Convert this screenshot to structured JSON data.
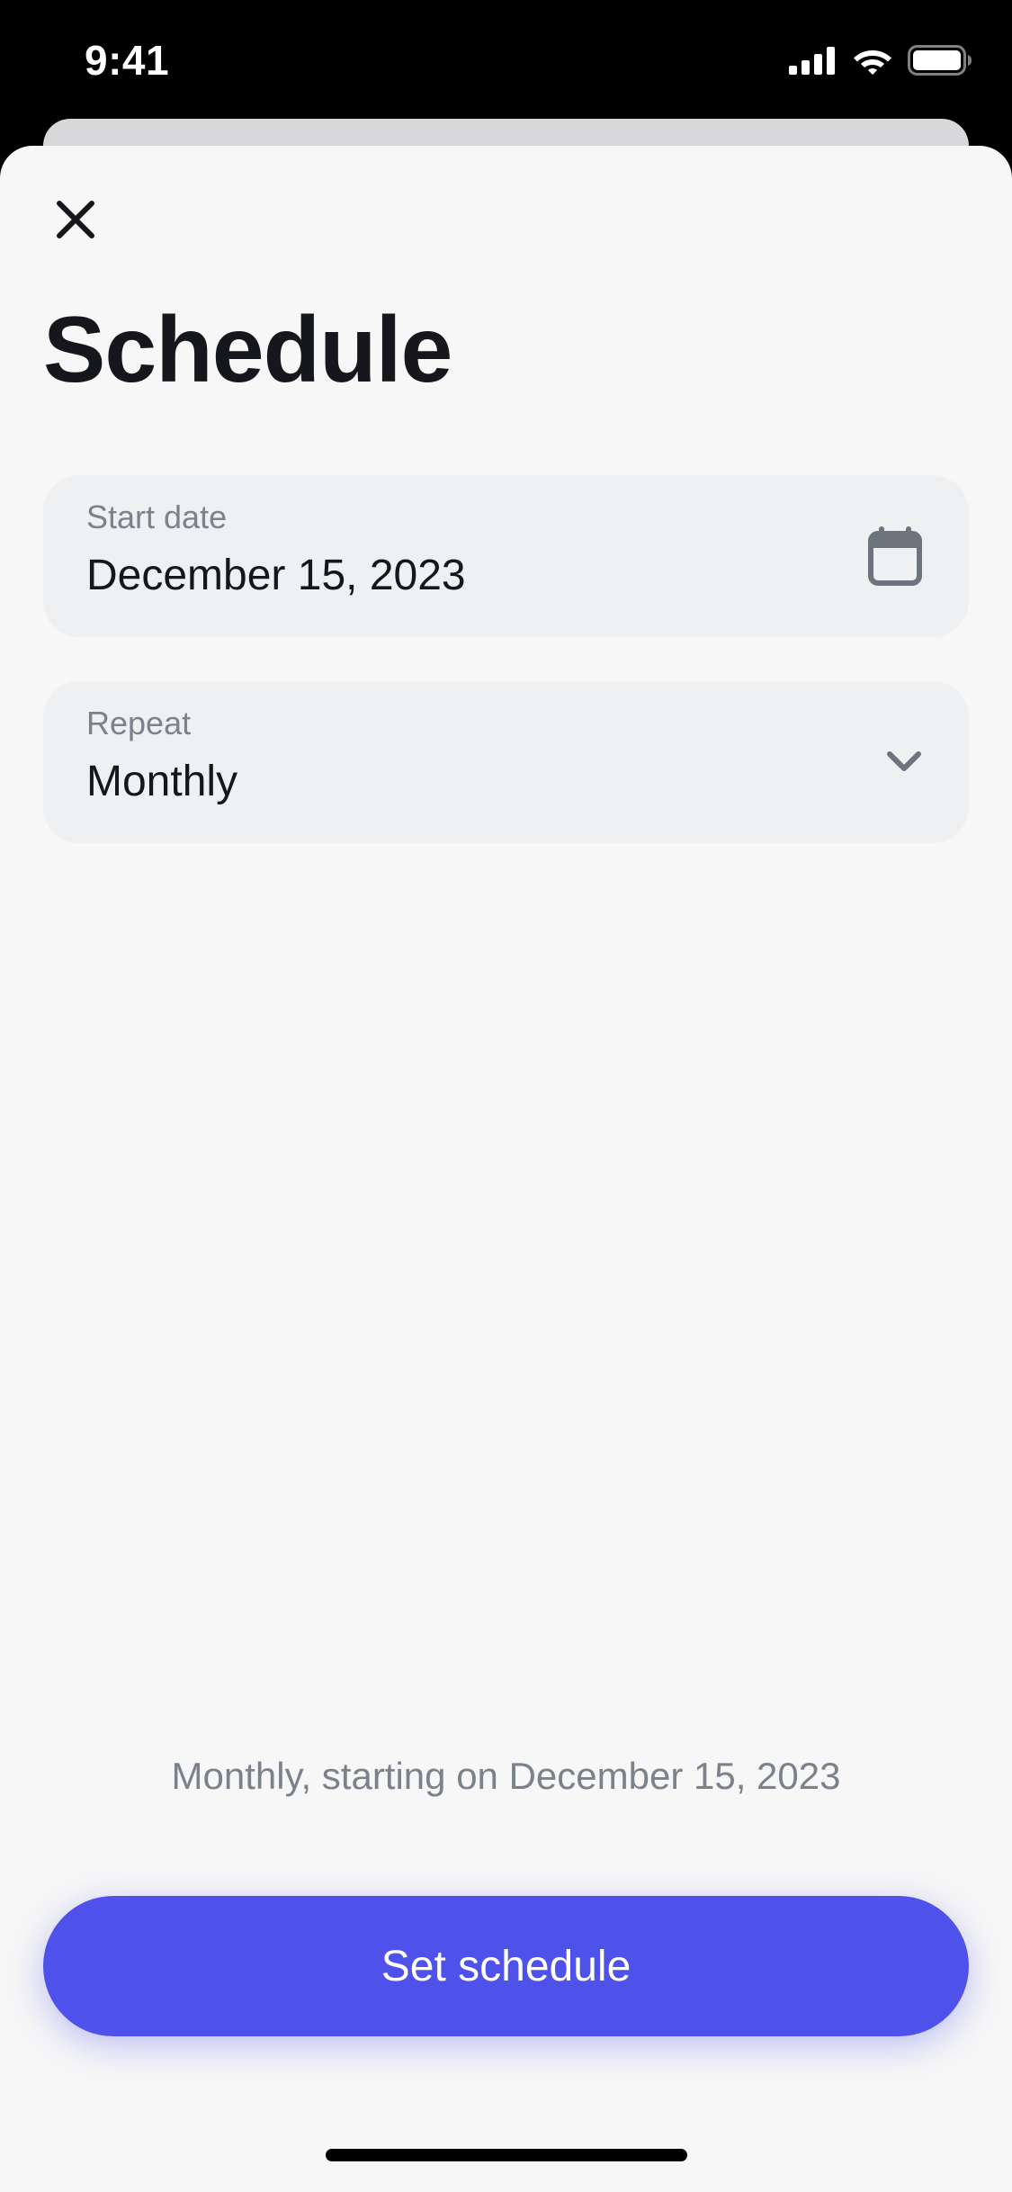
{
  "status_bar": {
    "time": "9:41",
    "icons": [
      "cellular-signal-icon",
      "wifi-icon",
      "battery-icon"
    ]
  },
  "sheet": {
    "close_icon": "close-icon",
    "title": "Schedule"
  },
  "start_date": {
    "label": "Start date",
    "value": "December 15, 2023",
    "icon": "calendar-icon"
  },
  "repeat": {
    "label": "Repeat",
    "value": "Monthly",
    "icon": "chevron-down-icon"
  },
  "summary": "Monthly, starting on December 15, 2023",
  "primary_button": {
    "label": "Set schedule"
  },
  "colors": {
    "accent": "#4f52ea",
    "background": "#f7f7f7",
    "field_background": "#eff0f2",
    "text_primary": "#15171c",
    "text_secondary": "#7b828c"
  }
}
